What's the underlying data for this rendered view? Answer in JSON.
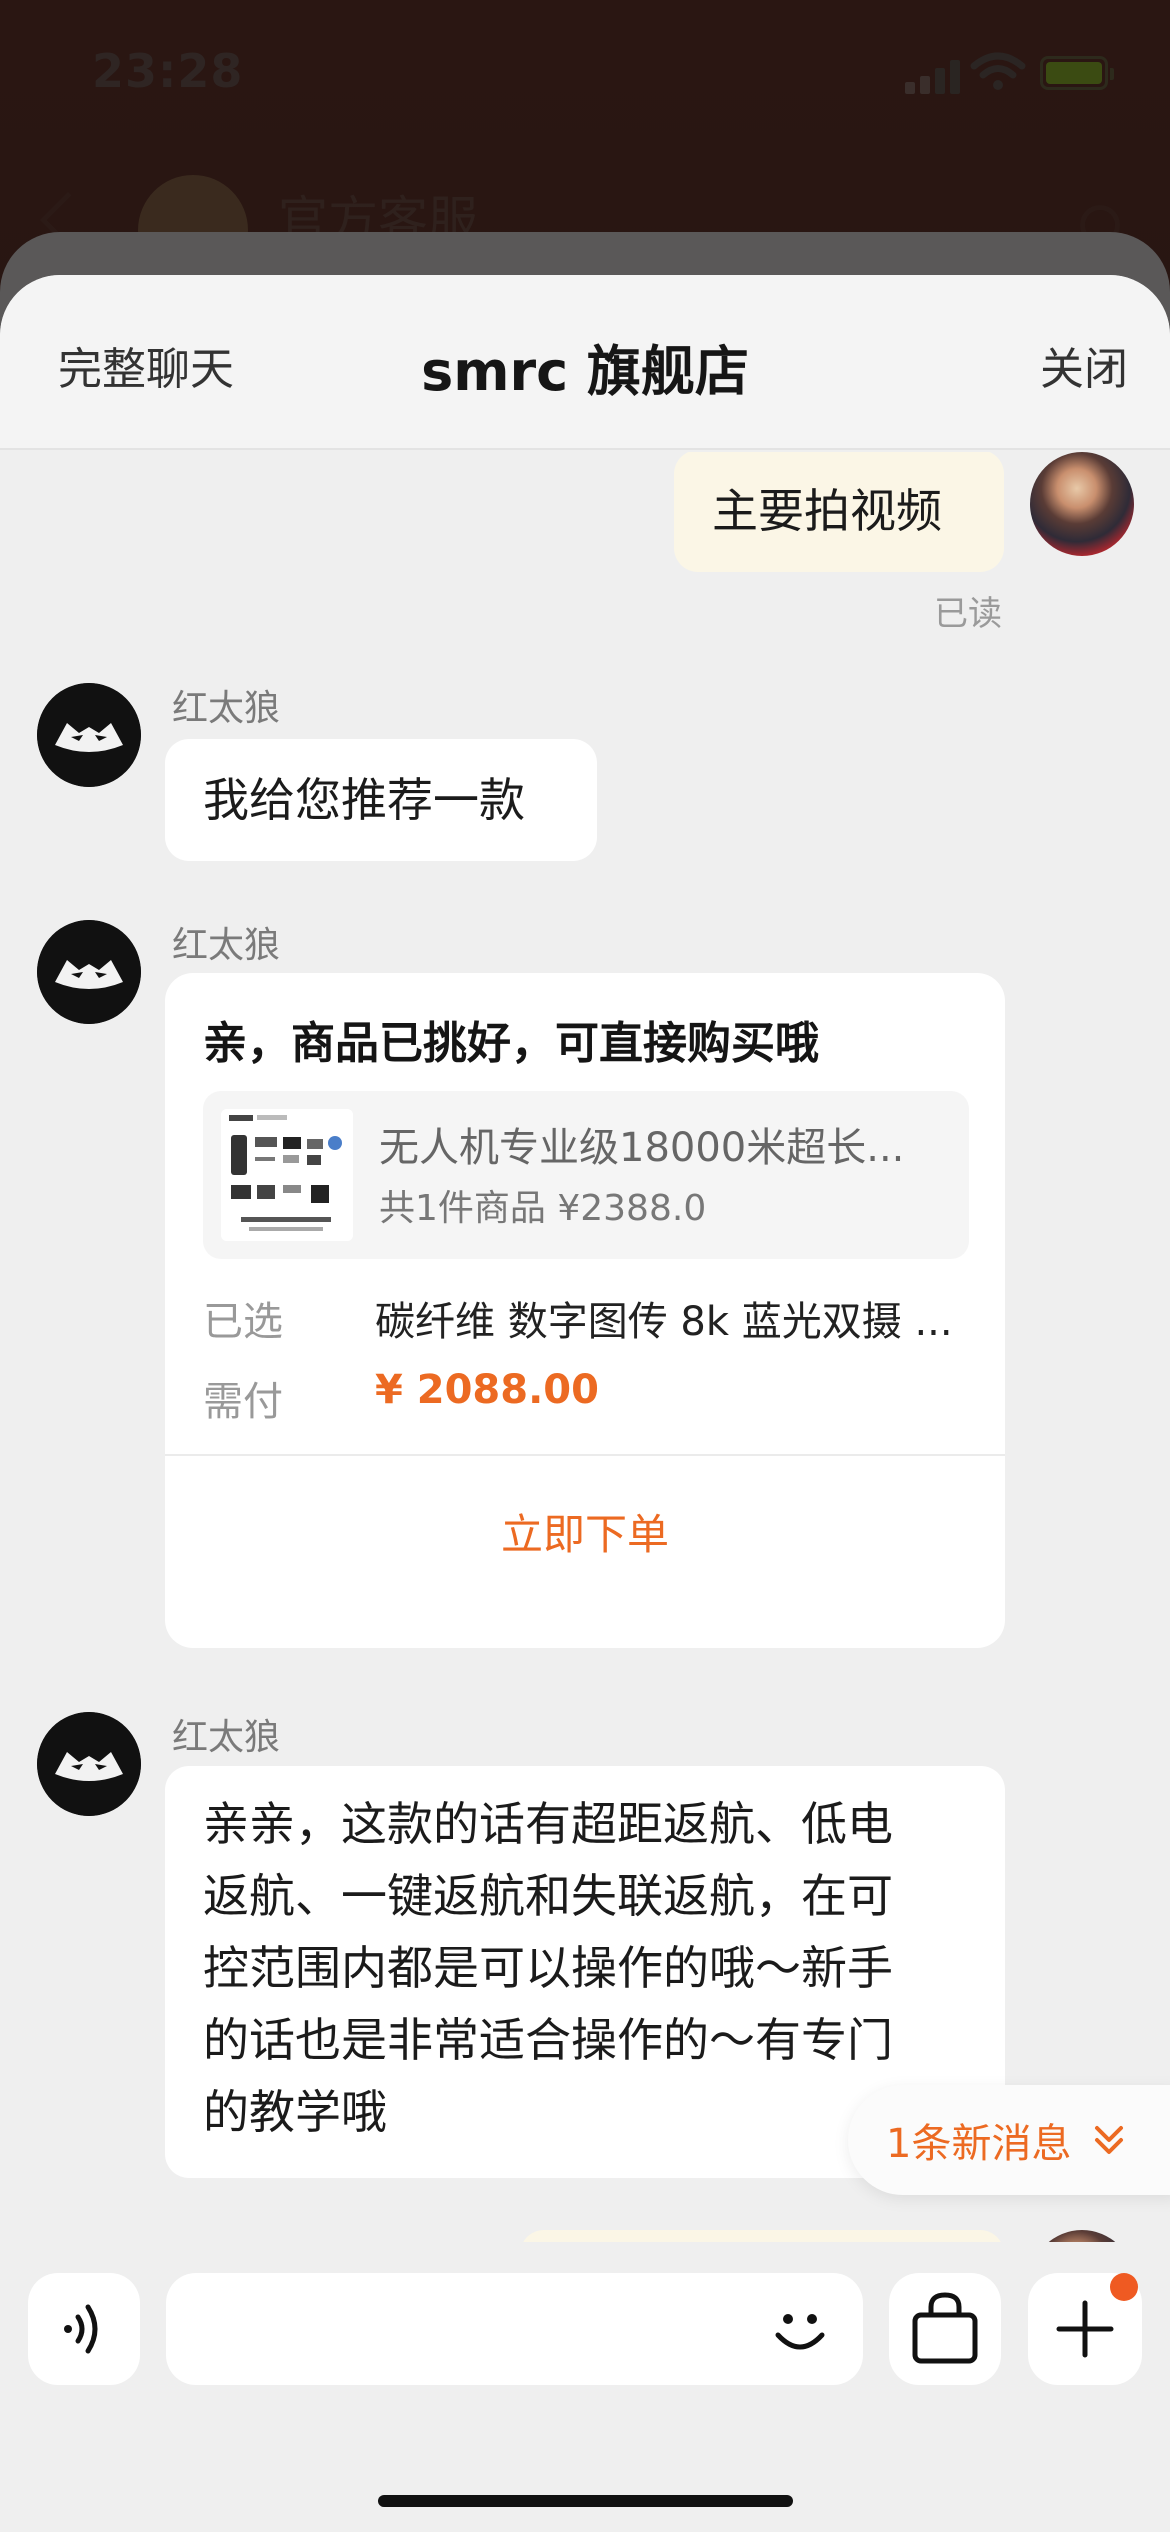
{
  "status_bar": {
    "time": "23:28"
  },
  "background_screen": {
    "title": "官方客服"
  },
  "sheet_header": {
    "full_chat_label": "完整聊天",
    "store_name": "smrc 旗舰店",
    "close_label": "关闭"
  },
  "messages": {
    "m1": {
      "text": "主要拍视频",
      "status": "已读"
    },
    "m2": {
      "sender": "红太狼",
      "text": "我给您推荐一款"
    },
    "m3": {
      "sender": "红太狼",
      "card": {
        "title": "亲，商品已挑好，可直接购买哦",
        "product_name": "无人机专业级18000米超长...",
        "product_meta": "共1件商品 ¥2388.0",
        "selected_label": "已选",
        "selected_value": "碳纤维 数字图传 8k 蓝光双摄 ...",
        "pay_label": "需付",
        "pay_value": "¥ 2088.00",
        "order_button": "立即下单"
      }
    },
    "m4": {
      "sender": "红太狼",
      "lines": [
        "亲亲，这款的话有超距返航、低电",
        "返航、一键返航和失联返航，在可",
        "控范围内都是可以操作的哦～新手",
        "的话也是非常适合操作的～有专门",
        "的教学哦"
      ]
    }
  },
  "new_message_pill": {
    "label": "1条新消息"
  },
  "input_bar": {
    "placeholder": ""
  },
  "colors": {
    "accent": "#ec6a22",
    "my_bubble": "#fbf6e6",
    "sheet_bg": "#efefef"
  }
}
